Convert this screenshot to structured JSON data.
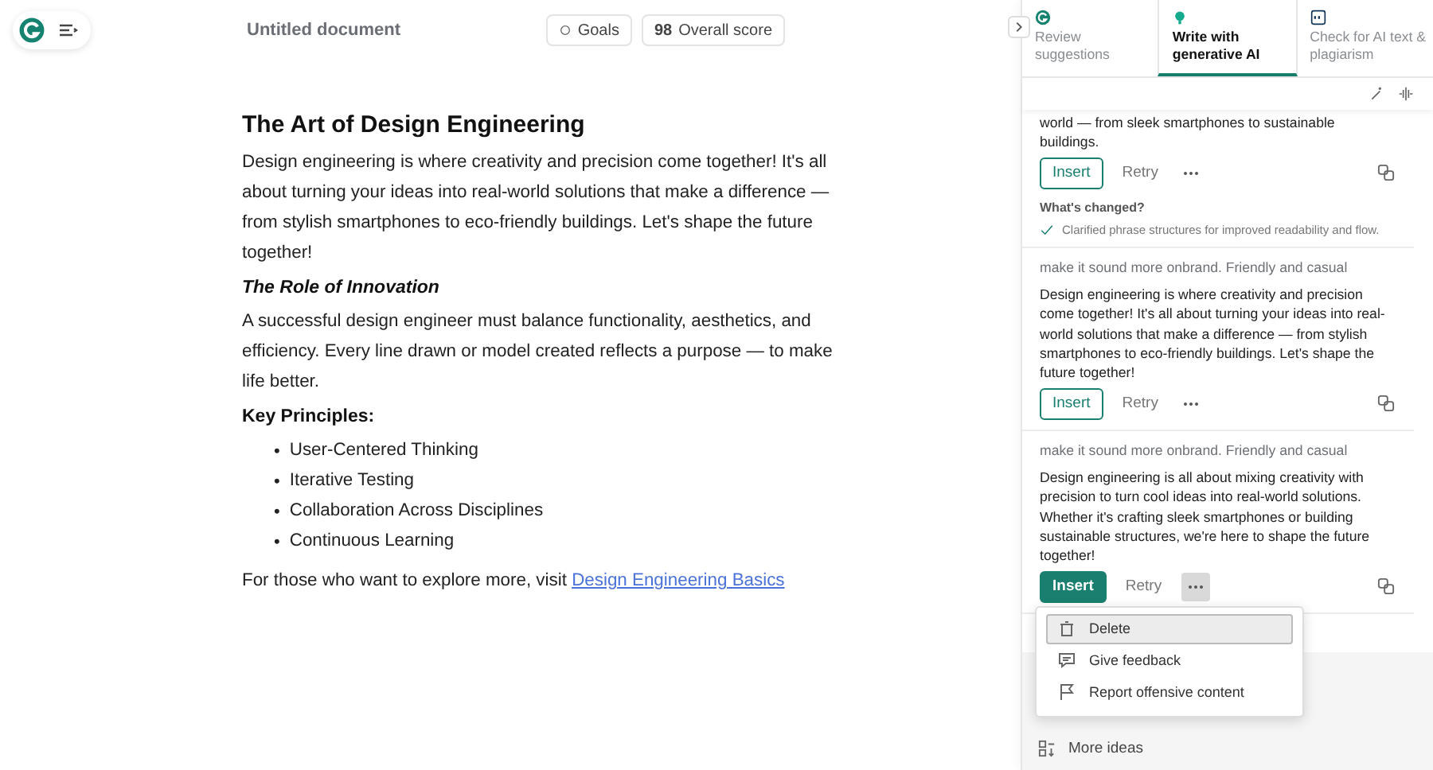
{
  "header": {
    "title": "Untitled document",
    "goals": "Goals",
    "score_value": "98",
    "score_label": "Overall score"
  },
  "document": {
    "title": "The Art of Design Engineering",
    "blocks": [
      {
        "kind": "paragraph",
        "text": "Design engineering is where creativity and precision come together! It's all about turning your ideas into real-world solutions that make a difference — from stylish smartphones to eco-friendly buildings. Let's shape the future together!"
      },
      {
        "kind": "subheading",
        "text": "The Role of Innovation"
      },
      {
        "kind": "paragraph",
        "text": "A successful design engineer must balance functionality, aesthetics, and efficiency. Every line drawn or model created reflects a purpose — to make life better."
      },
      {
        "kind": "heading",
        "text": "Key Principles:"
      },
      {
        "kind": "list",
        "items": [
          {
            "bullet": "•",
            "text": "User-Centered Thinking"
          },
          {
            "bullet": "•",
            "text": "Iterative Testing"
          },
          {
            "bullet": "•",
            "text": "Collaboration Across Disciplines"
          },
          {
            "bullet": "•",
            "text": "Continuous Learning"
          }
        ]
      },
      {
        "kind": "link_paragraph",
        "text": "For those who want to explore more, visit ",
        "link": "Design Engineering Basics"
      }
    ]
  },
  "panel": {
    "tabs": [
      {
        "label": "Review suggestions",
        "selected": false
      },
      {
        "label": "Write with generative AI",
        "selected": true
      },
      {
        "label": "Check for AI text & plagiarism",
        "selected": false
      }
    ],
    "cards": [
      {
        "text": "world — from sleek smartphones to sustainable buildings.",
        "insert": "Insert",
        "retry": "Retry",
        "highlighted": false,
        "menu_open": false,
        "changes_title": "What's changed?",
        "changes": [
          "Clarified phrase structures for improved readability and flow."
        ]
      },
      {
        "prompt": "make it sound more onbrand. Friendly and casual",
        "text": "Design engineering is where creativity and precision come together! It's all about turning your ideas into real-world solutions that make a difference — from stylish smartphones to eco-friendly buildings. Let's shape the future together!",
        "insert": "Insert",
        "retry": "Retry",
        "highlighted": false,
        "menu_open": false
      },
      {
        "prompt": "make it sound more onbrand. Friendly and casual",
        "text": "Design engineering is all about mixing creativity with precision to turn cool ideas into real-world solutions. Whether it's crafting sleek smartphones or building sustainable structures, we're here to shape the future together!",
        "insert": "Insert",
        "retry": "Retry",
        "highlighted": true,
        "menu_open": true
      }
    ],
    "menu": [
      {
        "label": "Delete",
        "selected": true
      },
      {
        "label": "Give feedback",
        "selected": false
      },
      {
        "label": "Report offensive content",
        "selected": false
      }
    ],
    "more_ideas": "More ideas"
  }
}
